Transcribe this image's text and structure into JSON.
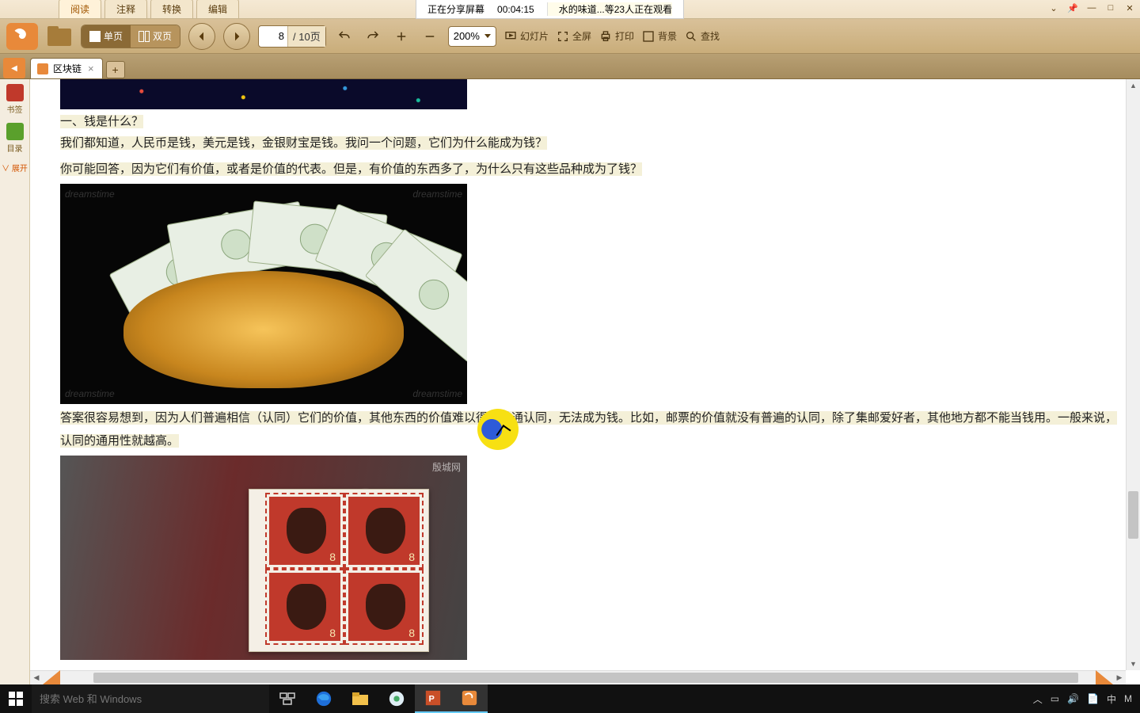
{
  "menu": {
    "tabs": [
      "阅读",
      "注释",
      "转换",
      "编辑"
    ],
    "active": 0
  },
  "window_controls": [
    "⌄",
    "📌",
    "—",
    "□",
    "✕"
  ],
  "share": {
    "status": "正在分享屏幕",
    "timer": "00:04:15",
    "viewers": "水的味道...等23人正在观看"
  },
  "toolbar": {
    "view_single": "单页",
    "view_double": "双页",
    "page_current": "8",
    "page_total": "/ 10页",
    "zoom": "200%",
    "buttons": {
      "slides": "幻灯片",
      "fullscreen": "全屏",
      "print": "打印",
      "background": "背景",
      "find": "查找"
    }
  },
  "doctab": {
    "title": "区块链"
  },
  "side_rail": {
    "bookmark": "书签",
    "toc": "目录",
    "expand": "∨ 展开"
  },
  "document": {
    "heading": "一、钱是什么？",
    "p1": "我们都知道，人民币是钱，美元是钱，金银财宝是钱。我问一个问题，它们为什么能成为钱？",
    "p2": "你可能回答，因为它们有价值，或者是价值的代表。但是，有价值的东西多了，为什么只有这些品种成为了钱？",
    "p3": "答案很容易想到，因为人们普遍相信（认同）它们的价值，其他东西的价值难以得到普通认同，无法成为钱。比如，邮票的价值就没有普遍的认同，除了集邮爱好者，其他地方都不能当钱用。一般来说，认同的通用性就越高。",
    "stamp_value": "8",
    "stamp_wm": "殷城网"
  },
  "taskbar": {
    "search_placeholder": "搜索 Web 和 Windows",
    "ime": "中",
    "brand": "M"
  }
}
